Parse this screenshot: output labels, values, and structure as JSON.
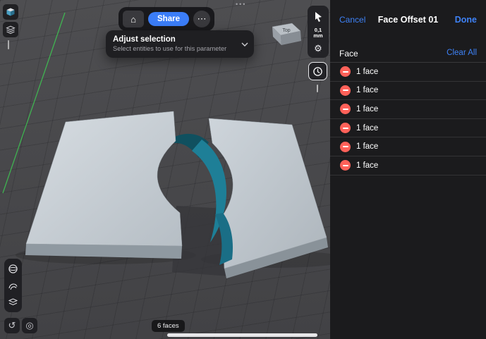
{
  "system": {
    "multitask_dots": "•••",
    "icons": {
      "home": "⌂",
      "more": "⋯",
      "gear": "⚙",
      "undo": "↺",
      "orbit": "◎"
    }
  },
  "viewport": {
    "toolbar": {
      "share_label": "Share"
    },
    "popup": {
      "title": "Adjust selection",
      "subtitle": "Select entities to use for this parameter"
    },
    "right_tools": {
      "snap_value": "0,1",
      "snap_unit": "mm"
    },
    "view_cube": {
      "top_label": "Top"
    },
    "faces_badge": "6 faces"
  },
  "panel": {
    "cancel_label": "Cancel",
    "title": "Face Offset 01",
    "done_label": "Done",
    "section": {
      "label": "Face",
      "clear_all_label": "Clear All"
    },
    "rows": [
      {
        "label": "1 face"
      },
      {
        "label": "1 face"
      },
      {
        "label": "1 face"
      },
      {
        "label": "1 face"
      },
      {
        "label": "1 face"
      },
      {
        "label": "1 face"
      }
    ]
  },
  "colors": {
    "accent_blue": "#3e82f7",
    "remove_red": "#ff6159",
    "teal_surface": "#1e7f97",
    "model_gray": "#c9d0d6",
    "viewport_bg": "#4a4a4d",
    "axis_green": "#3fbf52"
  }
}
